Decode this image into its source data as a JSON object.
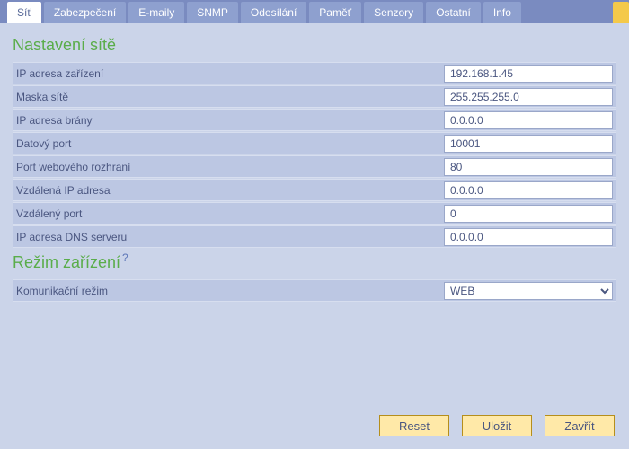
{
  "tabs": [
    {
      "label": "Síť"
    },
    {
      "label": "Zabezpečení"
    },
    {
      "label": "E-maily"
    },
    {
      "label": "SNMP"
    },
    {
      "label": "Odesílání"
    },
    {
      "label": "Paměť"
    },
    {
      "label": "Senzory"
    },
    {
      "label": "Ostatní"
    },
    {
      "label": "Info"
    }
  ],
  "active_tab_index": 0,
  "sections": {
    "network": {
      "title": "Nastavení sítě",
      "fields": {
        "device_ip": {
          "label": "IP adresa zařízení",
          "value": "192.168.1.45"
        },
        "netmask": {
          "label": "Maska sítě",
          "value": "255.255.255.0"
        },
        "gateway": {
          "label": "IP adresa brány",
          "value": "0.0.0.0"
        },
        "data_port": {
          "label": "Datový port",
          "value": "10001"
        },
        "web_port": {
          "label": "Port webového rozhraní",
          "value": "80"
        },
        "remote_ip": {
          "label": "Vzdálená IP adresa",
          "value": "0.0.0.0"
        },
        "remote_port": {
          "label": "Vzdálený port",
          "value": "0"
        },
        "dns_ip": {
          "label": "IP adresa DNS serveru",
          "value": "0.0.0.0"
        }
      }
    },
    "mode": {
      "title": "Režim zařízení",
      "help": "?",
      "fields": {
        "comm_mode": {
          "label": "Komunikační režim",
          "value": "WEB"
        }
      }
    }
  },
  "buttons": {
    "reset": "Reset",
    "save": "Uložit",
    "close": "Zavřít"
  }
}
